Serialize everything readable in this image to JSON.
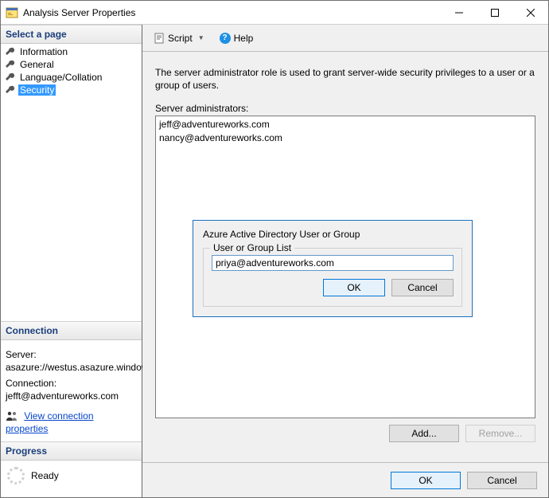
{
  "window": {
    "title": "Analysis Server Properties"
  },
  "sidebar": {
    "header": "Select a page",
    "items": [
      {
        "label": "Information"
      },
      {
        "label": "General"
      },
      {
        "label": "Language/Collation"
      },
      {
        "label": "Security"
      }
    ]
  },
  "connection": {
    "header": "Connection",
    "server_label": "Server:",
    "server_value": "asazure://westus.asazure.windows",
    "connection_label": "Connection:",
    "connection_value": "jefft@adventureworks.com",
    "link": "View connection properties"
  },
  "progress": {
    "header": "Progress",
    "status": "Ready"
  },
  "toolbar": {
    "script": "Script",
    "help": "Help"
  },
  "main": {
    "description": "The server administrator role is used to grant server-wide security privileges to a user or a group of users.",
    "list_label": "Server administrators:",
    "admins": [
      "jeff@adventureworks.com",
      "nancy@adventureworks.com"
    ],
    "add": "Add...",
    "remove": "Remove..."
  },
  "footer": {
    "ok": "OK",
    "cancel": "Cancel"
  },
  "modal": {
    "title": "Azure Active Directory User or Group",
    "legend": "User or Group List",
    "value": "priya@adventureworks.com",
    "ok": "OK",
    "cancel": "Cancel"
  }
}
